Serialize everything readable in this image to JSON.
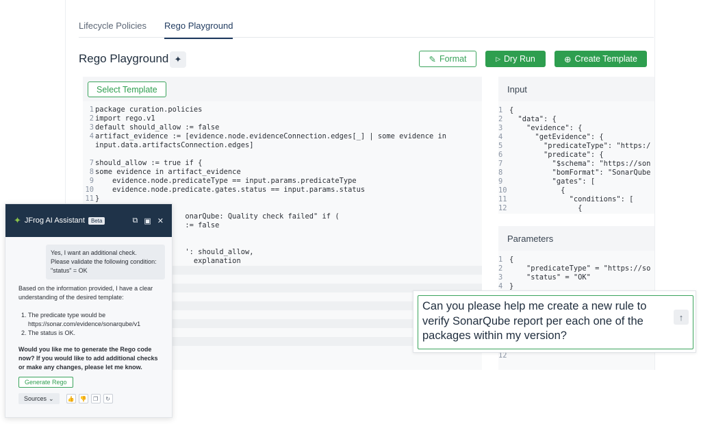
{
  "tabs": [
    {
      "label": "Lifecycle Policies",
      "active": false
    },
    {
      "label": "Rego Playground",
      "active": true
    }
  ],
  "page": {
    "title": "Rego Playground"
  },
  "toolbar": {
    "format_label": "Format",
    "dry_run_label": "Dry Run",
    "create_template_label": "Create Template"
  },
  "editor": {
    "select_template_label": "Select Template",
    "lines": [
      {
        "n": "1",
        "text": "package curation.policies"
      },
      {
        "n": "2",
        "text": "import rego.v1"
      },
      {
        "n": "3",
        "text": "default should_allow := false"
      },
      {
        "n": "4",
        "text": "artifact_evidence := [evidence.node.evidenceConnection.edges[_] | some evidence in"
      },
      {
        "n": "",
        "text": "input.data.artifactsConnection.edges]"
      },
      {
        "n": "",
        "text": ""
      },
      {
        "n": "7",
        "text": "should_allow := true if {"
      },
      {
        "n": "8",
        "text": "some evidence in artifact_evidence"
      },
      {
        "n": "9",
        "text": "    evidence.node.predicateType == input.params.predicateType"
      },
      {
        "n": "10",
        "text": "    evidence.node.predicate.gates.status == input.params.status"
      },
      {
        "n": "11",
        "text": "}"
      },
      {
        "n": "",
        "text": ""
      },
      {
        "n": "",
        "text": "                     onarQube: Quality check failed\" if ("
      },
      {
        "n": "",
        "text": "                     := false"
      },
      {
        "n": "",
        "text": ""
      },
      {
        "n": "",
        "text": ""
      },
      {
        "n": "",
        "text": "                     ': should_allow,"
      },
      {
        "n": "",
        "text": "                       explanation"
      }
    ]
  },
  "input_panel": {
    "title": "Input",
    "lines": [
      {
        "n": "1",
        "text": "{"
      },
      {
        "n": "2",
        "text": "  \"data\": {"
      },
      {
        "n": "3",
        "text": "    \"evidence\": {"
      },
      {
        "n": "4",
        "text": "      \"getEvidence\": {"
      },
      {
        "n": "5",
        "text": "        \"predicateType\": \"https:/"
      },
      {
        "n": "6",
        "text": "        \"predicate\": {"
      },
      {
        "n": "7",
        "text": "          \"$schema\": \"https://son"
      },
      {
        "n": "8",
        "text": "          \"bomFormat\": \"SonarQube"
      },
      {
        "n": "9",
        "text": "          \"gates\": ["
      },
      {
        "n": "10",
        "text": "            {"
      },
      {
        "n": "11",
        "text": "              \"conditions\": ["
      },
      {
        "n": "12",
        "text": "                {"
      }
    ]
  },
  "params_panel": {
    "title": "Parameters",
    "lines": [
      {
        "n": "1",
        "text": "{"
      },
      {
        "n": "2",
        "text": "    \"predicateType\" = \"https://so"
      },
      {
        "n": "3",
        "text": "    \"status\" = \"OK\""
      },
      {
        "n": "4",
        "text": "}"
      }
    ],
    "extra_line_number": "12"
  },
  "chat_prompt": {
    "text": "Can you please help me create a new rule to verify SonarQube report per each one of the packages within my version?"
  },
  "assistant": {
    "title": "JFrog AI Assistant",
    "badge": "Beta",
    "user_message": [
      "Yes, I want an additional check.",
      "Please validate the following condition:",
      "\"status\" = OK"
    ],
    "intro": "Based on the information provided, I have a clear understanding of the desired template:",
    "points": [
      "The predicate type would be https://sonar.com/evidence/sonarqube/v1",
      "The status is OK."
    ],
    "question": "Would you like me to generate the Rego code now? If you would like to add additional checks or make any changes, please let me know.",
    "generate_label": "Generate Rego",
    "sources_label": "Sources"
  },
  "colors": {
    "accent": "#2e9e4f",
    "header": "#1f3349"
  }
}
